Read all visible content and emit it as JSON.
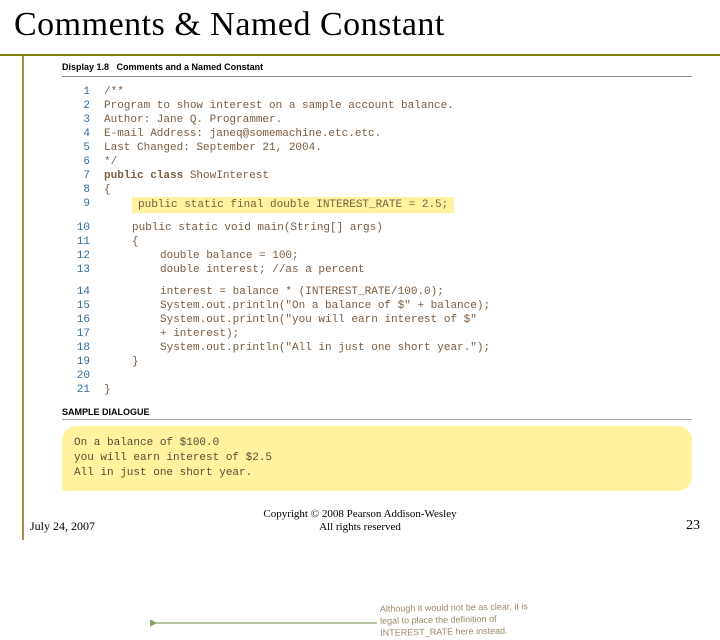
{
  "title": "Comments & Named Constant",
  "display": {
    "label": "Display 1.8",
    "caption": "Comments and a Named Constant"
  },
  "code": {
    "lines": [
      {
        "n": "1",
        "text": "/**"
      },
      {
        "n": "2",
        "text": " Program to show interest on a sample account balance."
      },
      {
        "n": "3",
        "text": " Author: Jane Q. Programmer."
      },
      {
        "n": "4",
        "text": " E-mail Address: janeq@somemachine.etc.etc."
      },
      {
        "n": "5",
        "text": " Last Changed: September 21, 2004."
      },
      {
        "n": "6",
        "text": "*/"
      },
      {
        "n": "7",
        "text_prefix": "public class ",
        "text_suffix": "ShowInterest"
      },
      {
        "n": "8",
        "text": "{"
      },
      {
        "n": "9",
        "highlight": "public static final double INTEREST_RATE = 2.5;",
        "indent": 1
      }
    ],
    "lines2": [
      {
        "n": "10",
        "text": "public static void main(String[] args)",
        "indent": 1
      },
      {
        "n": "11",
        "text": "{",
        "indent": 1
      },
      {
        "n": "12",
        "text": "double balance = 100;",
        "indent": 2
      },
      {
        "n": "13",
        "text": "double interest; //as a percent",
        "indent": 2
      }
    ],
    "lines3": [
      {
        "n": "14",
        "text": "interest = balance * (INTEREST_RATE/100.0);",
        "indent": 2
      },
      {
        "n": "15",
        "text": "System.out.println(\"On a balance of $\" + balance);",
        "indent": 2
      },
      {
        "n": "16",
        "text": "System.out.println(\"you will earn interest of $\"",
        "indent": 2
      },
      {
        "n": "17",
        "text": "                                     + interest);",
        "indent": 2
      },
      {
        "n": "18",
        "text": "System.out.println(\"All in just one short year.\");",
        "indent": 2
      },
      {
        "n": "19",
        "text": "}",
        "indent": 1
      },
      {
        "n": "20",
        "text": ""
      },
      {
        "n": "21",
        "text": "}"
      }
    ]
  },
  "note": {
    "l1": "Although it would not be as clear, it is",
    "l2": "legal to place the definition of",
    "l3": "INTEREST_RATE here instead."
  },
  "sample": {
    "heading": "SAMPLE DIALOGUE",
    "l1": "On a balance of $100.0",
    "l2": "you will earn interest of $2.5",
    "l3": "All in just one short year."
  },
  "footer": {
    "date": "July 24, 2007",
    "copy_l1": "Copyright © 2008 Pearson Addison-Wesley",
    "copy_l2": "All rights reserved",
    "page": "23"
  }
}
